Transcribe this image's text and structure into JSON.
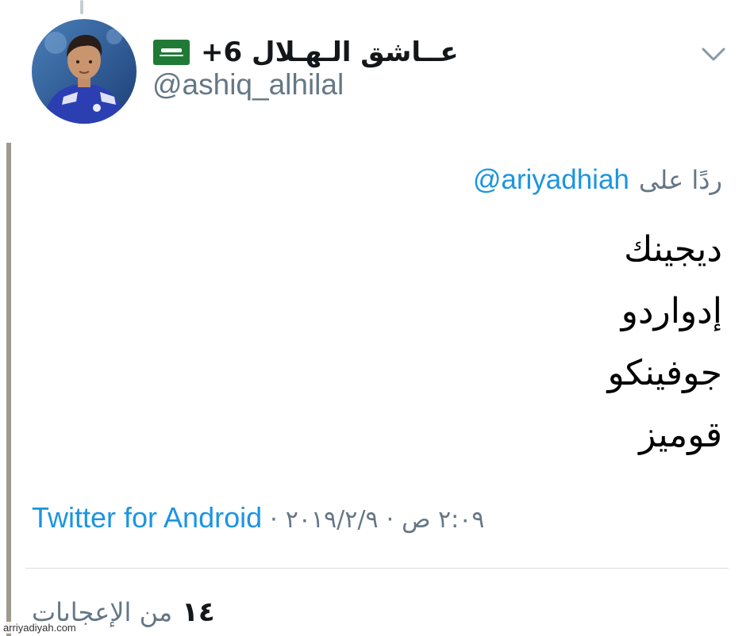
{
  "tweet": {
    "author": {
      "display_name": "عــاشق الـهـلال 6+",
      "handle": "@ashiq_alhilal",
      "flag_icon": "saudi-flag-icon",
      "avatar_icon": "profile-photo"
    },
    "reply": {
      "prefix": "ردًا على",
      "mention": "@ariyadhiah"
    },
    "text_lines": [
      "ديجينك",
      "إدواردو",
      "جوفينكو",
      "قوميز"
    ],
    "meta": {
      "time": "٢:٠٩ ص",
      "separator": "·",
      "date": "٢٠١٩/٢/٩",
      "source": "Twitter for Android"
    },
    "likes": {
      "count": "١٤",
      "label": "من الإعجابات"
    }
  },
  "watermark": "arriyadiyah.com",
  "colors": {
    "link": "#1b95e0",
    "muted": "#657786",
    "text": "#14171a",
    "flag_green": "#1f7a36",
    "rule": "#9e9a91"
  }
}
